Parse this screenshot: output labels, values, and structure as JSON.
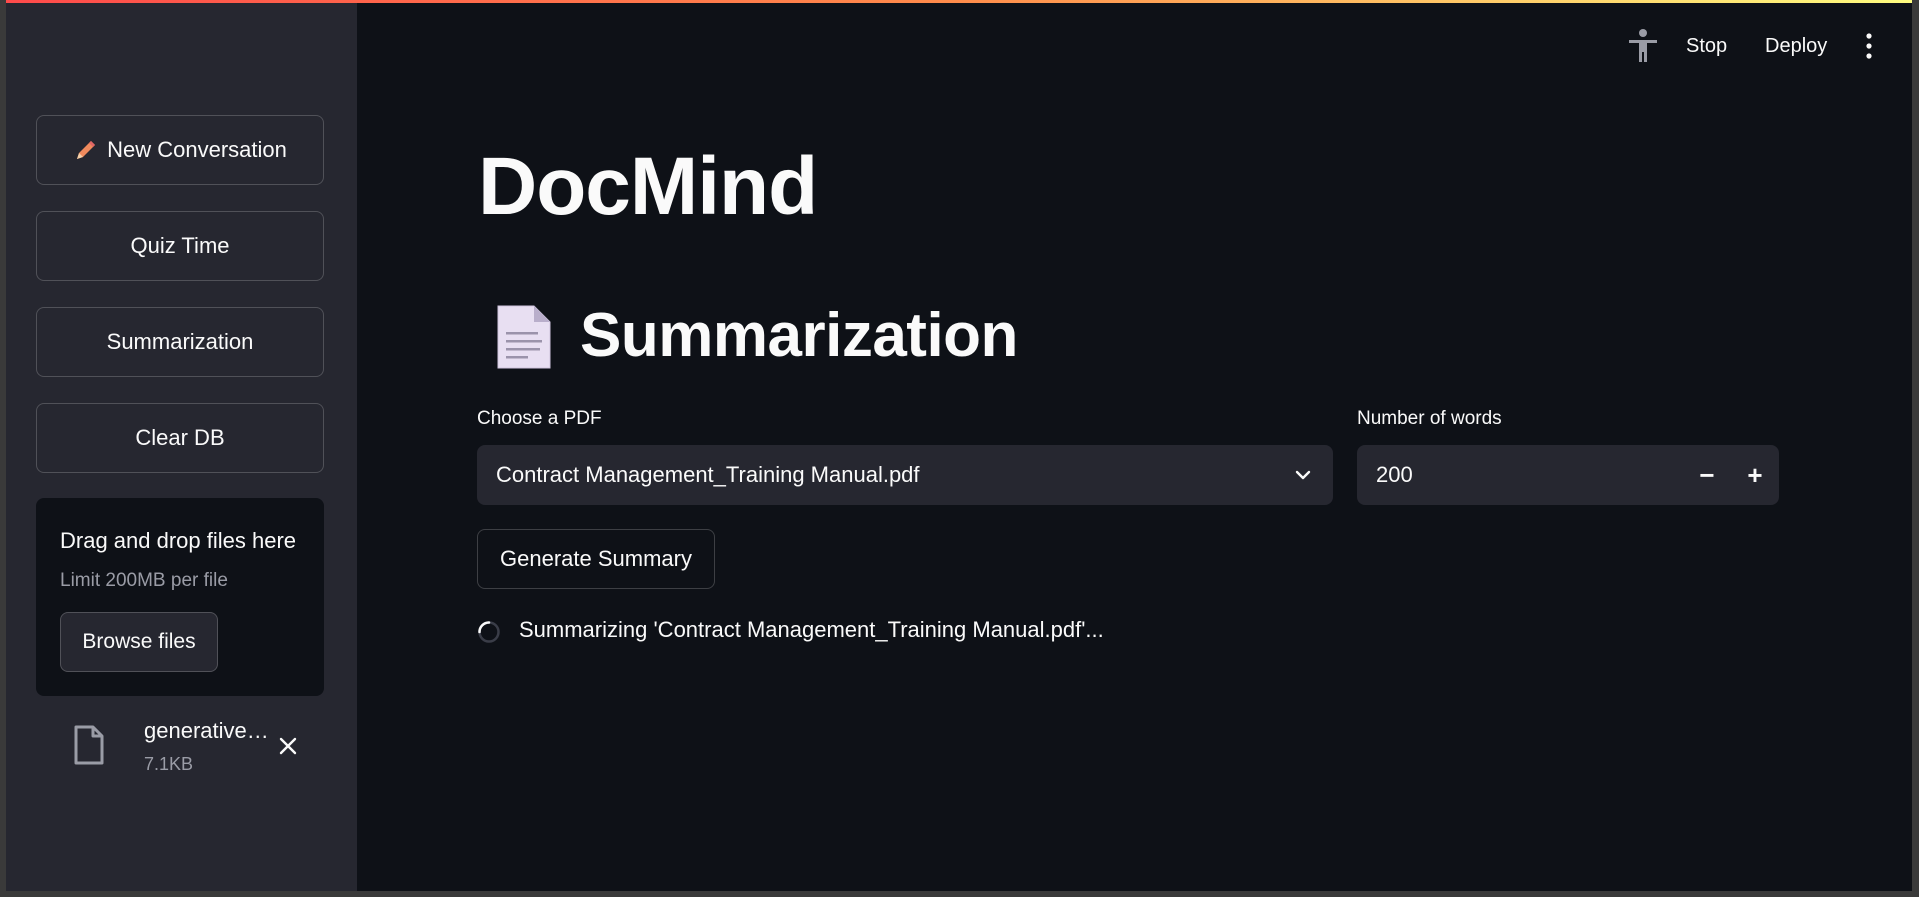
{
  "header": {
    "stop_label": "Stop",
    "deploy_label": "Deploy",
    "icons": [
      "accessibility-icon",
      "more-vertical-icon"
    ]
  },
  "sidebar": {
    "buttons": [
      {
        "label": "New Conversation",
        "icon": "pencil-icon"
      },
      {
        "label": "Quiz Time"
      },
      {
        "label": "Summarization"
      },
      {
        "label": "Clear DB"
      }
    ],
    "uploader": {
      "drag_text": "Drag and drop files here",
      "limit_text": "Limit 200MB per file",
      "browse_label": "Browse files"
    },
    "file": {
      "name": "generative…",
      "size": "7.1KB"
    }
  },
  "main": {
    "title": "DocMind",
    "section_title": "Summarization",
    "section_icon": "document-icon",
    "pdf_label": "Choose a PDF",
    "pdf_selected": "Contract Management_Training Manual.pdf",
    "words_label": "Number of words",
    "words_value": "200",
    "minus": "−",
    "plus": "+",
    "generate_label": "Generate Summary",
    "status_text": "Summarizing 'Contract Management_Training Manual.pdf'..."
  },
  "colors": {
    "background": "#0e1117",
    "sidebar": "#262730",
    "text": "#fafafa",
    "accent_gradient_start": "#ff4b4b",
    "accent_gradient_end": "#fffd80"
  }
}
